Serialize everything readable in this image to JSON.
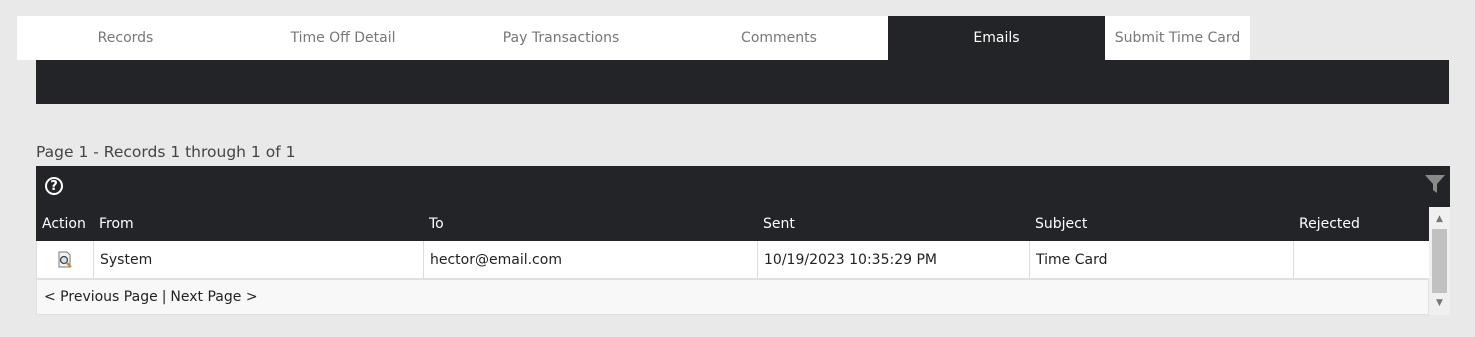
{
  "tabs": [
    {
      "label": "Records",
      "active": false
    },
    {
      "label": "Time Off Detail",
      "active": false
    },
    {
      "label": "Pay Transactions",
      "active": false
    },
    {
      "label": "Comments",
      "active": false
    },
    {
      "label": "Emails",
      "active": true
    },
    {
      "label": "Submit Time Card",
      "active": false
    }
  ],
  "pager": {
    "summary": "Page 1 - Records 1 through 1 of 1",
    "previous_label": "< Previous Page",
    "separator": "|",
    "next_label": "Next Page >"
  },
  "toolbar": {
    "help_icon": "help-circle-icon",
    "help_glyph": "?",
    "filter_icon": "filter-funnel-icon"
  },
  "table": {
    "columns": [
      "Action",
      "From",
      "To",
      "Sent",
      "Subject",
      "Rejected"
    ],
    "rows": [
      {
        "action_icon": "view-document-magnifier-icon",
        "from": "System",
        "to": "hector@email.com",
        "sent": "10/19/2023 10:35:29 PM",
        "subject": "Time Card",
        "rejected": ""
      }
    ]
  },
  "scrollbar": {
    "up_glyph": "▲",
    "down_glyph": "▼"
  },
  "colors": {
    "dark_header": "#222428",
    "background": "#e9e9e9",
    "active_tab_text": "#ffffff",
    "inactive_tab_text": "#777777"
  }
}
